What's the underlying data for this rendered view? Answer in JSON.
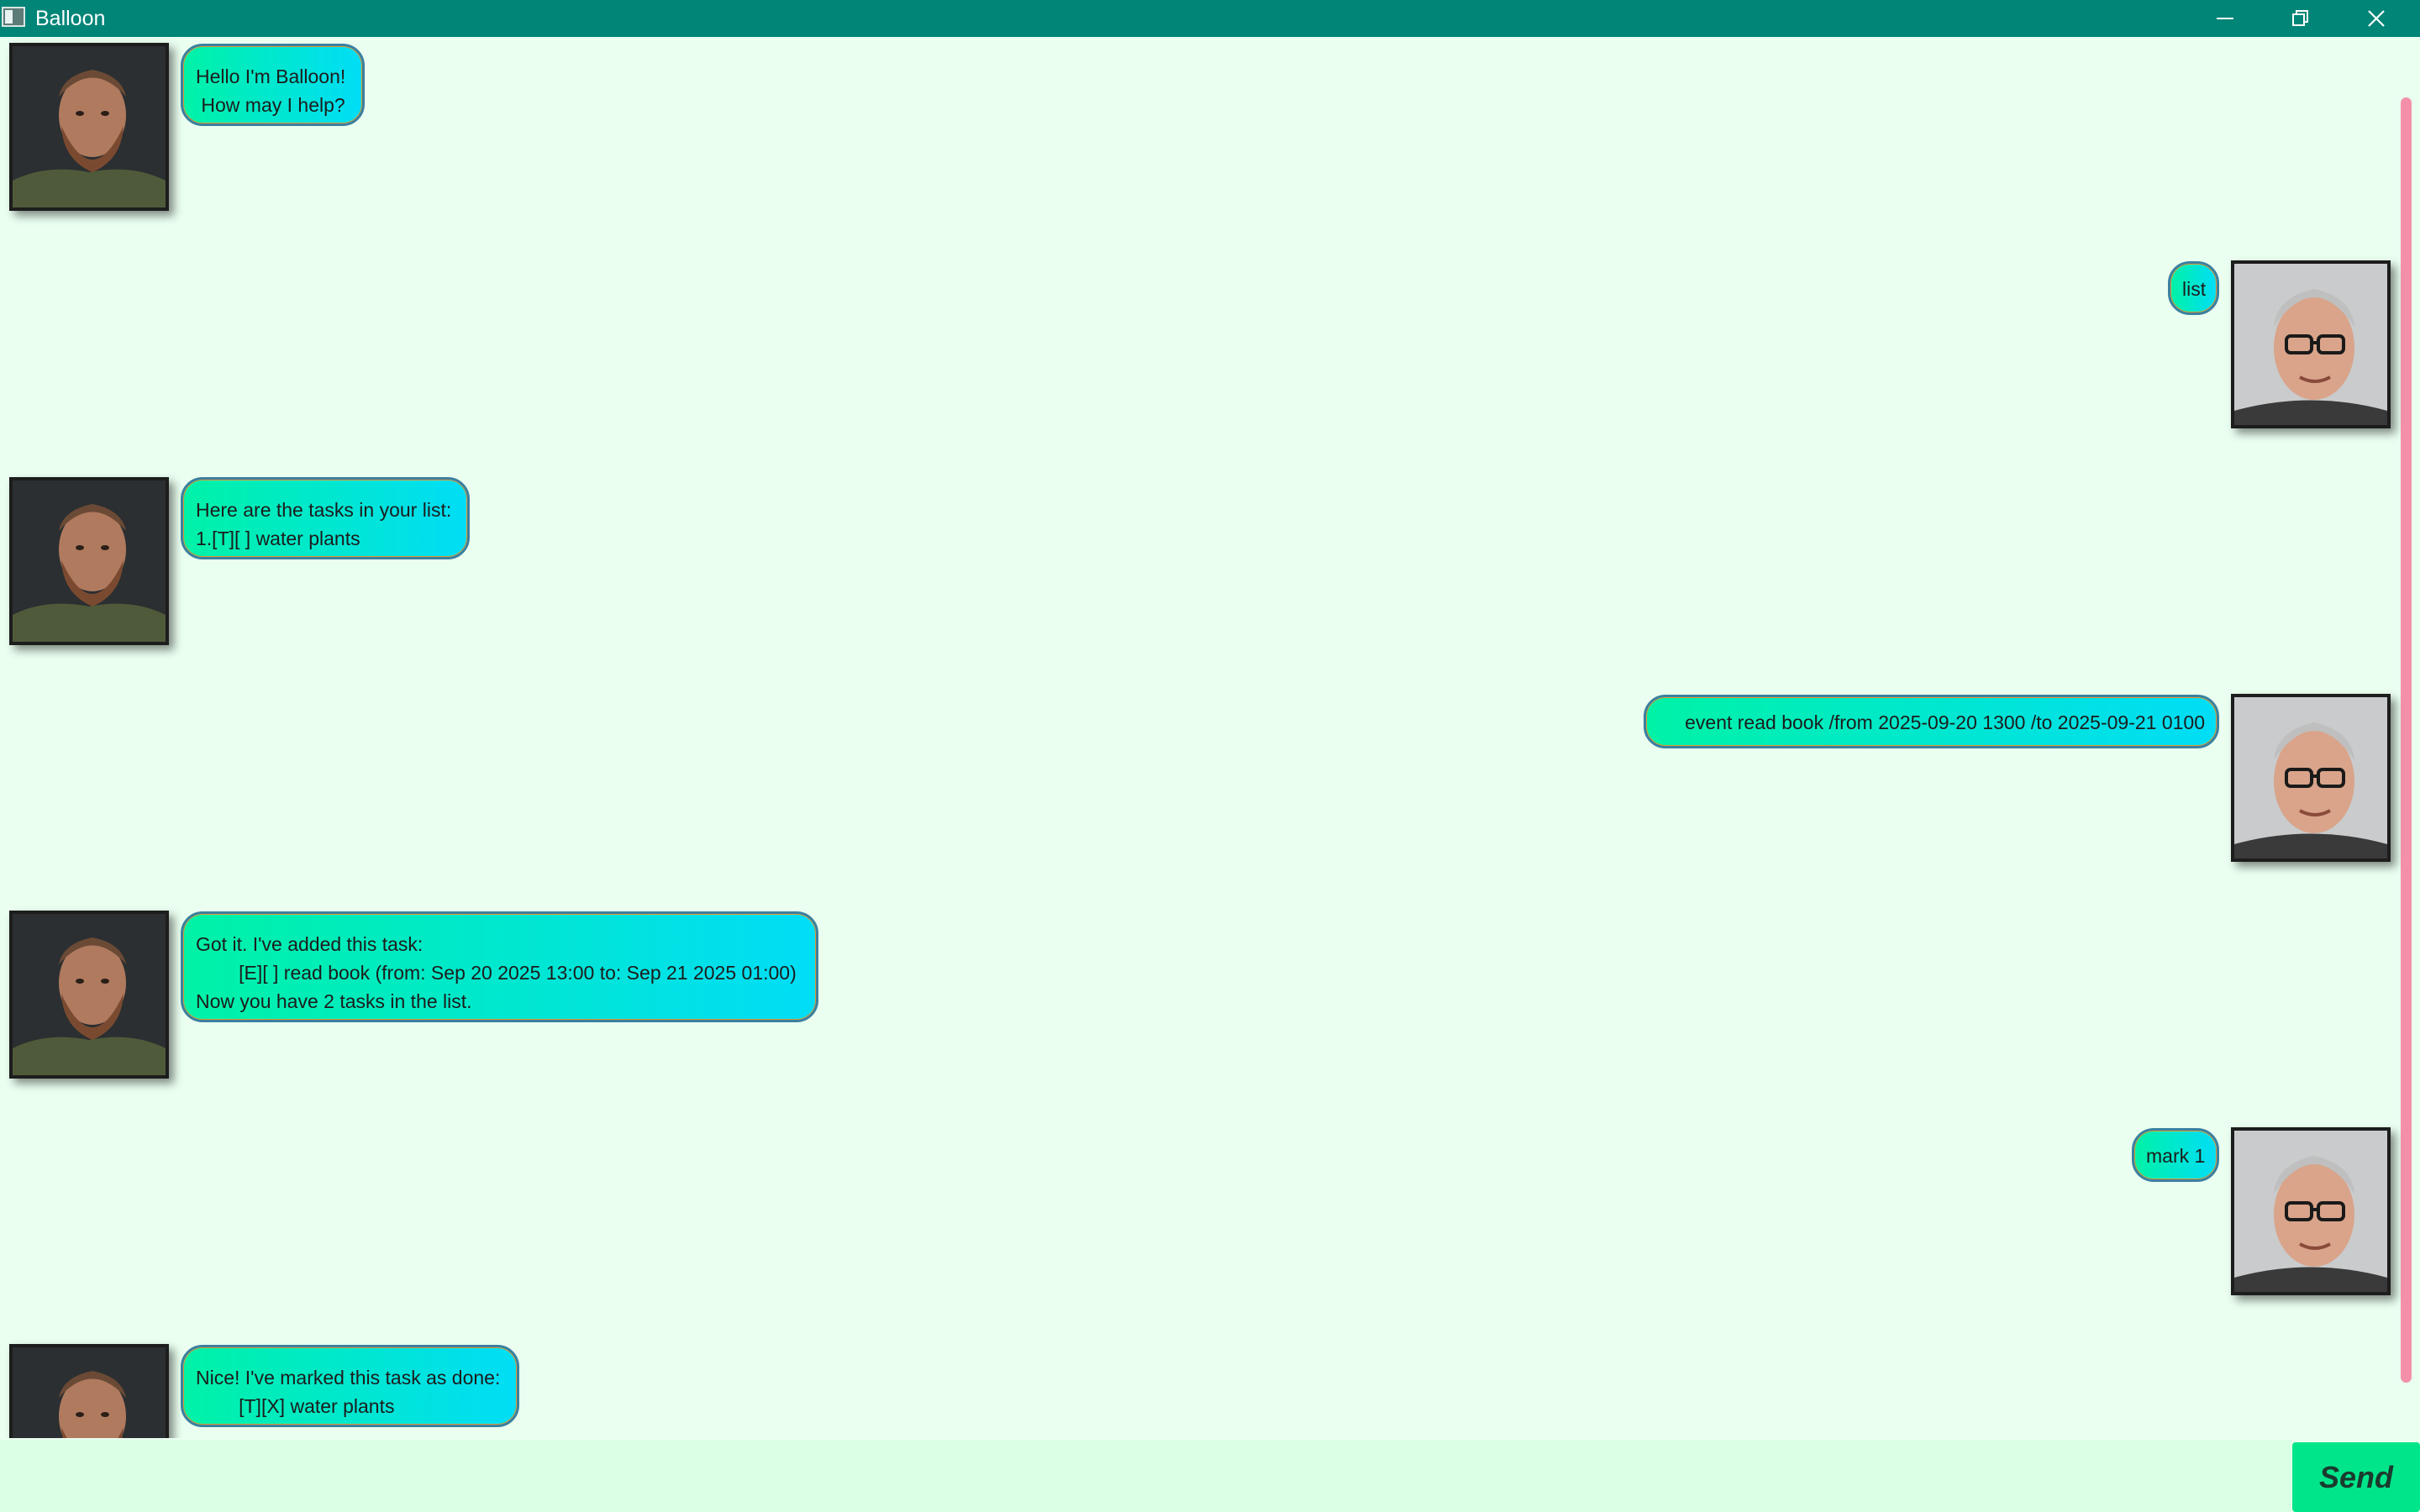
{
  "window": {
    "title": "Balloon"
  },
  "messages": [
    {
      "sender": "bot",
      "text": "Hello I'm Balloon!\n How may I help?"
    },
    {
      "sender": "user",
      "text": "list"
    },
    {
      "sender": "bot",
      "text": "Here are the tasks in your list:\n1.[T][ ] water plants"
    },
    {
      "sender": "user",
      "text": "event read book /from 2025-09-20 1300 /to 2025-09-21 0100"
    },
    {
      "sender": "bot",
      "text": "Got it. I've added this task:\n        [E][ ] read book (from: Sep 20 2025 13:00 to: Sep 21 2025 01:00)\nNow you have 2 tasks in the list."
    },
    {
      "sender": "user",
      "text": "mark 1"
    },
    {
      "sender": "bot",
      "text": "Nice! I've marked this task as done:\n        [T][X] water plants"
    }
  ],
  "input": {
    "value": "",
    "placeholder": ""
  },
  "send_label": "Send",
  "colors": {
    "titlebar": "#008577",
    "background": "#eafff0",
    "bubble_gradient_start": "#00f2a6",
    "bubble_gradient_end": "#00ddf7",
    "scrollbar": "#f390a8",
    "input_background": "#dbffe4",
    "send_button": "#00e58a"
  },
  "icons": [
    "minimize-icon",
    "restore-icon",
    "close-icon",
    "app-icon"
  ]
}
